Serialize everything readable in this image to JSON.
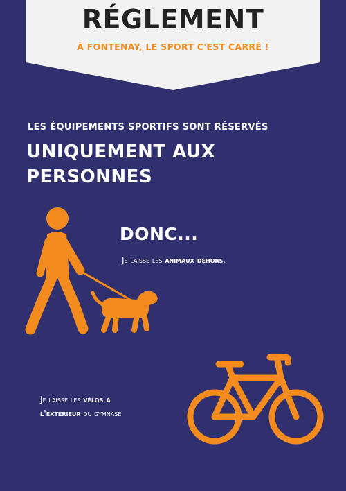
{
  "header": {
    "title": "RÉGLEMENT",
    "tagline": "À FONTENAY, LE SPORT C'EST CARRÉ !"
  },
  "intro": {
    "line": "LES ÉQUIPEMENTS SPORTIFS SONT RÉSERVÉS",
    "headline_1": "UNIQUEMENT AUX",
    "headline_2": "PERSONNES"
  },
  "rule_animals": {
    "heading": "DONC...",
    "text_before": "Je laisse les ",
    "text_strong": "animaux dehors",
    "text_after": "."
  },
  "rule_bikes": {
    "line1_before": "Je laisse les ",
    "line1_strong": "vélos à",
    "line2_strong": "l'extérieur",
    "line2_after": " du gymnase"
  },
  "colors": {
    "background": "#30306e",
    "banner": "#f2f2f2",
    "accent": "#f38b1f",
    "text": "#ffffff"
  },
  "icons": [
    "person-walking-dog-icon",
    "bicycle-icon"
  ]
}
